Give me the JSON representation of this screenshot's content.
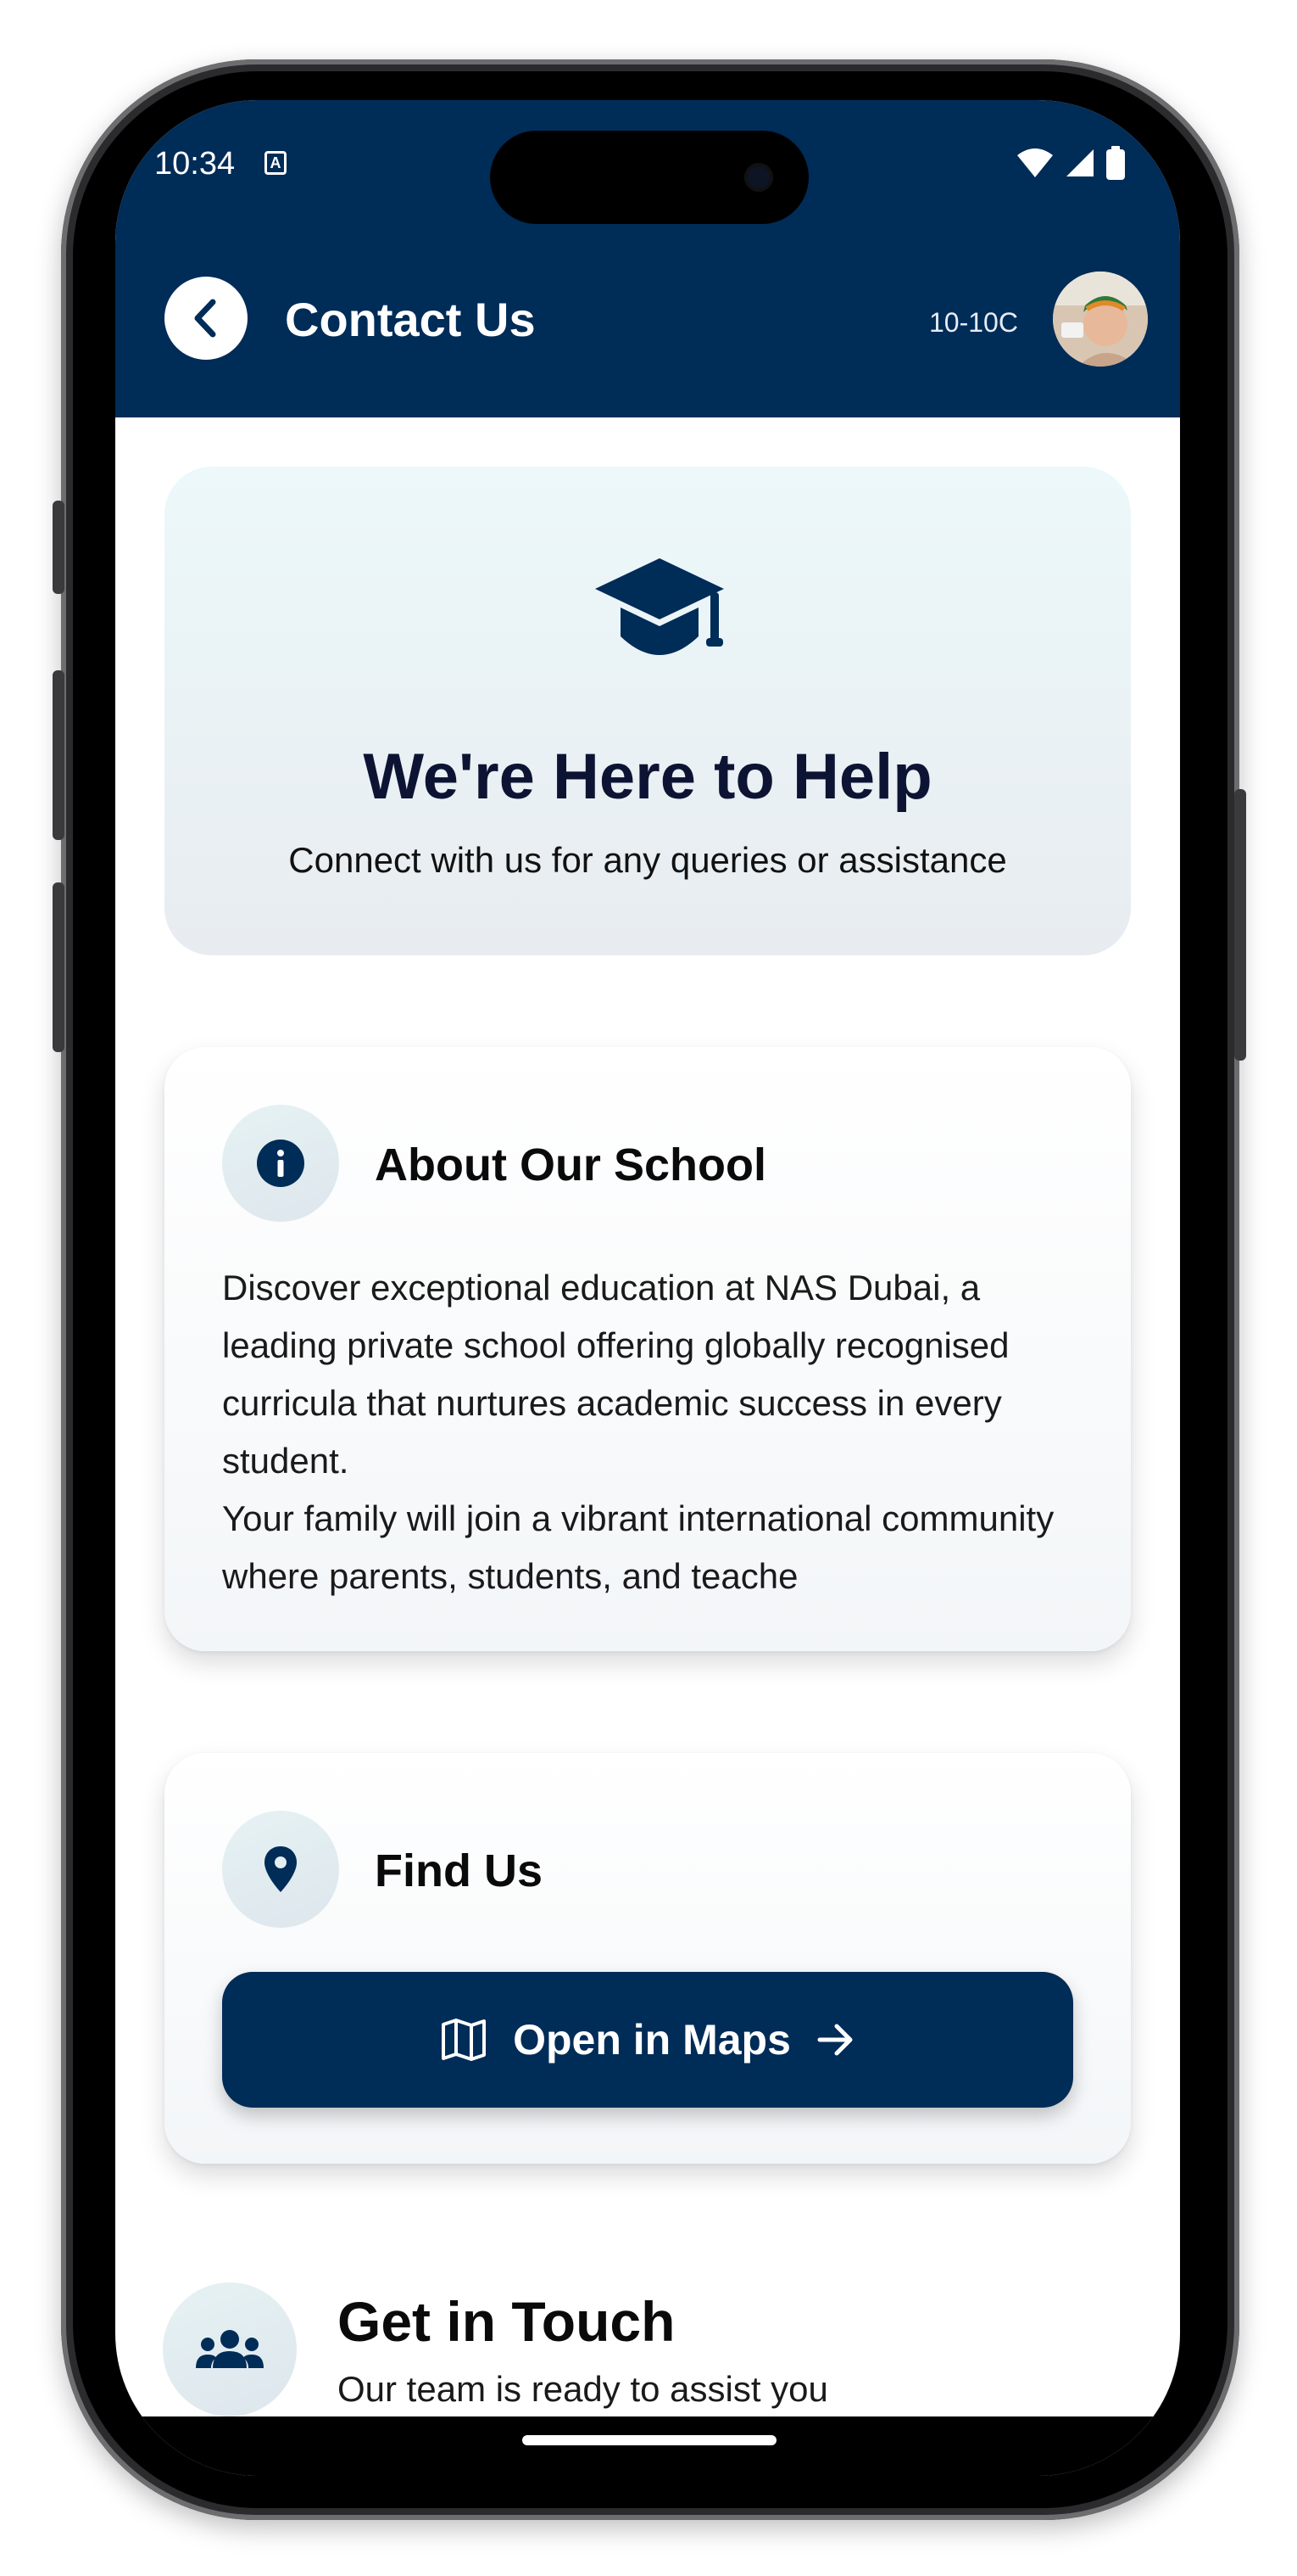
{
  "status_bar": {
    "time": "10:34",
    "a_badge": "A"
  },
  "header": {
    "title": "Contact Us",
    "class_code": "10-10C",
    "background_color": "#002c58"
  },
  "hero": {
    "icon": "graduation-cap-icon",
    "title": "We're Here to Help",
    "subtitle": "Connect with us for any queries or assistance"
  },
  "about": {
    "icon": "info-icon",
    "title": "About Our School",
    "text": "Discover exceptional education at NAS Dubai, a leading private school offering globally recognised curricula that nurtures academic success in every student.\nYour family will join a vibrant international community where parents, students, and teache"
  },
  "find_us": {
    "icon": "location-pin-icon",
    "title": "Find Us",
    "button_label": "Open in Maps",
    "button_icon": "map-icon",
    "button_arrow_icon": "arrow-right-icon"
  },
  "get_in_touch": {
    "icon": "group-icon",
    "title": "Get in Touch",
    "subtitle": "Our team is ready to assist you"
  }
}
